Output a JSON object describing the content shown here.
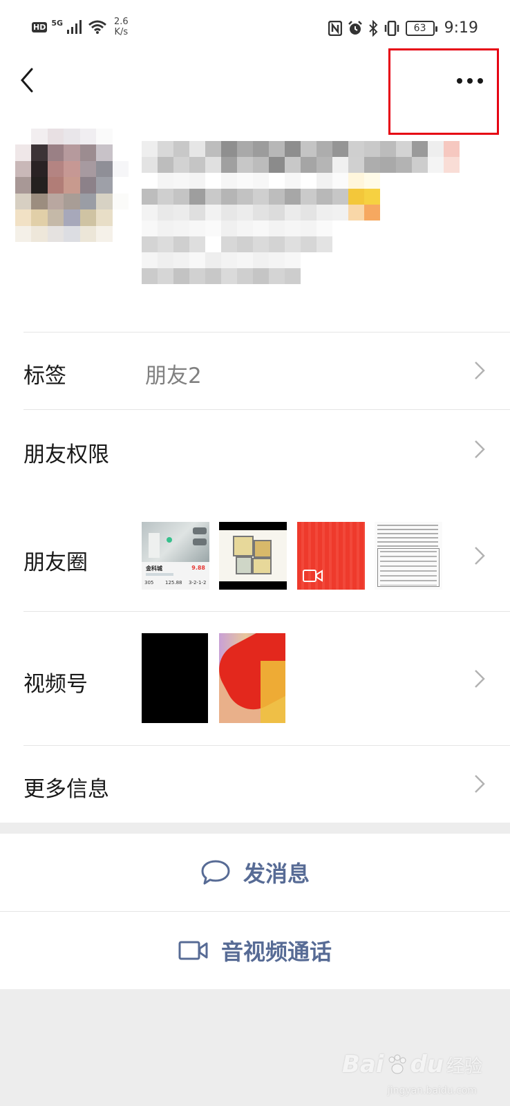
{
  "status_bar": {
    "hd": "HD",
    "signal_type": "5G",
    "net_speed_value": "2.6",
    "net_speed_unit": "K/s",
    "battery": "63",
    "time": "9:19"
  },
  "rows": {
    "tag_label": "标签",
    "tag_value": "朋友2",
    "permission_label": "朋友权限",
    "moments_label": "朋友圈",
    "channels_label": "视频号",
    "more_info_label": "更多信息"
  },
  "moments_thumb1": {
    "title": "金科城",
    "price": "9.88",
    "stat1": "305",
    "stat2": "125.88",
    "stat3": "3-2-1-2"
  },
  "actions": {
    "send_message": "发消息",
    "av_call": "音视频通话"
  },
  "watermark": {
    "brand": "Bai",
    "brand2": "du",
    "suffix": "经验",
    "url": "jingyan.baidu.com"
  },
  "colors": {
    "highlight_box": "#e60012",
    "link_blue": "#576b95"
  }
}
